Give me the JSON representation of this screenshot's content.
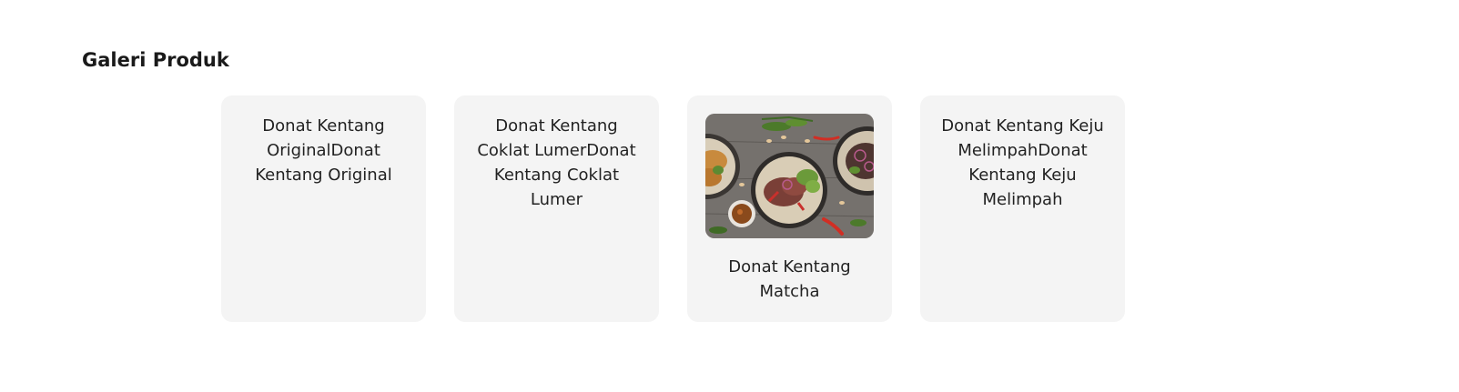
{
  "section": {
    "title": "Galeri Produk"
  },
  "products": [
    {
      "text": "Donat Kentang OriginalDonat Kentang Original"
    },
    {
      "text": "Donat Kentang Coklat LumerDonat Kentang Coklat Lumer"
    },
    {
      "text": "Donat Kentang Matcha",
      "image": "food-dishes-photo"
    },
    {
      "text": "Donat Kentang Keju MelimpahDonat Kentang Keju Melimpah"
    }
  ]
}
